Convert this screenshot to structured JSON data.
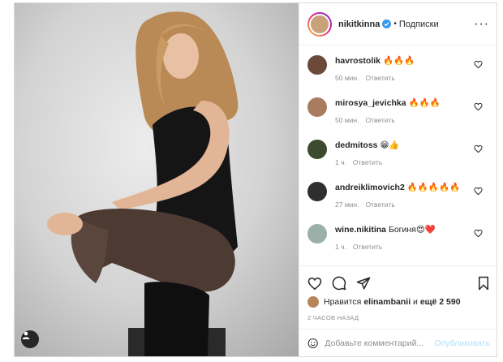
{
  "header": {
    "username": "nikitkinna",
    "separator": "•",
    "follow_label": "Подписки",
    "more_label": "···"
  },
  "comments": [
    {
      "user": "havrostolik",
      "text": "🔥🔥🔥",
      "time": "50 мин.",
      "reply": "Ответить",
      "avatar_color": "#6b4a3a"
    },
    {
      "user": "mirosya_jevichka",
      "text": "🔥🔥🔥",
      "time": "50 мин.",
      "reply": "Ответить",
      "avatar_color": "#a97c5f"
    },
    {
      "user": "dedmitoss",
      "text": "😁👍",
      "time": "1 ч.",
      "reply": "Ответить",
      "avatar_color": "#3c4a2e"
    },
    {
      "user": "andreiklimovich2",
      "text": "🔥🔥🔥🔥🔥",
      "time": "27 мин.",
      "reply": "Ответить",
      "avatar_color": "#2f2f2f"
    },
    {
      "user": "wine.nikitina",
      "text": "Богиня😍❤️",
      "time": "1 ч.",
      "reply": "Ответить",
      "avatar_color": "#9bb0a8"
    }
  ],
  "likes": {
    "prefix": "Нравится ",
    "user": "elinambanii",
    "middle": " и ",
    "count": "ещё 2 590"
  },
  "posted_ago": "2 ЧАСОВ НАЗАД",
  "add_comment": {
    "placeholder": "Добавьте комментарий...",
    "publish_label": "Опубликовать"
  },
  "colors": {
    "accent": "#0095f6",
    "publish_disabled": "#b2dffc",
    "muted": "#8e8e8e",
    "text": "#262626"
  }
}
